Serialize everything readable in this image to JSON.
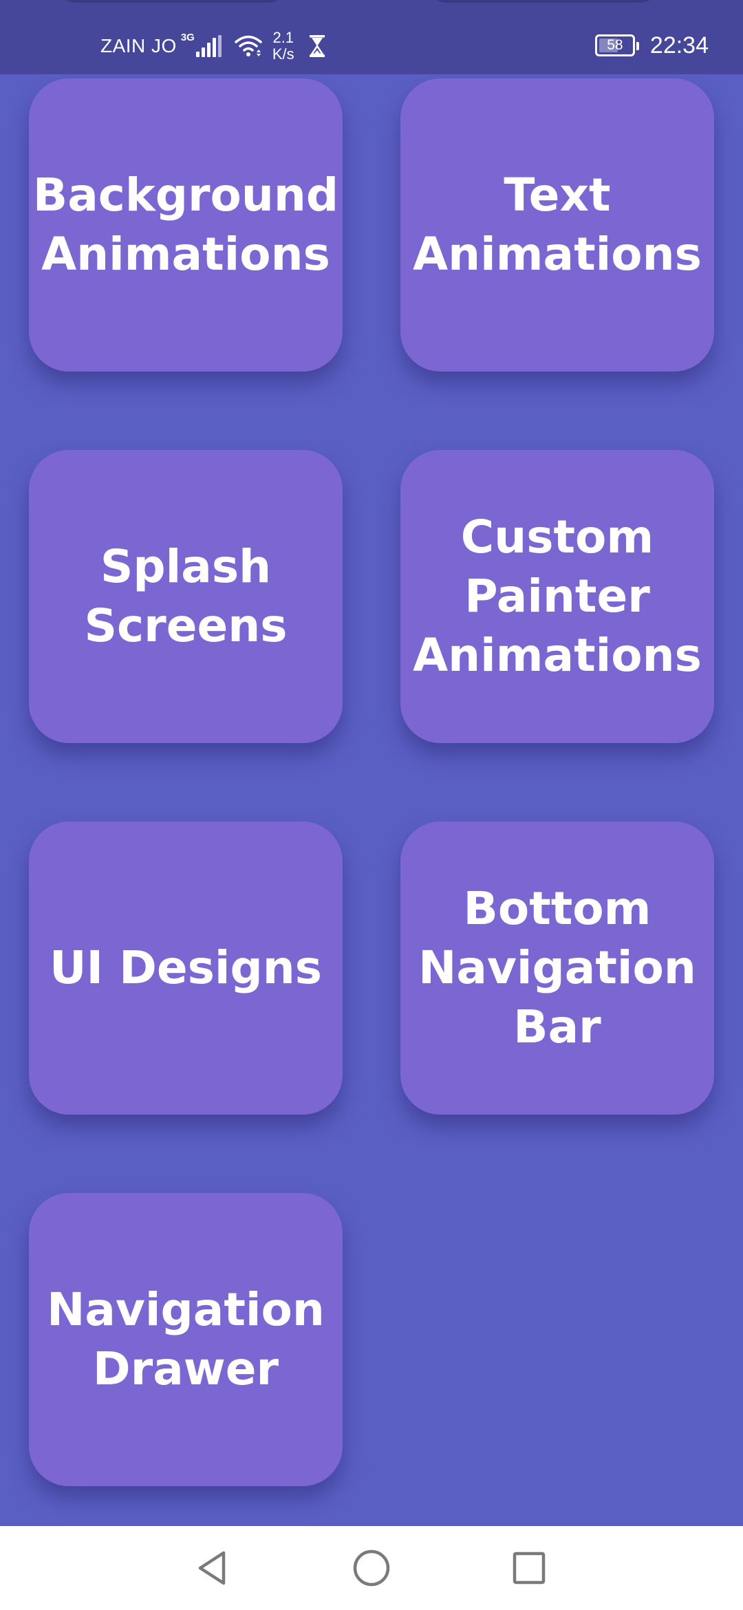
{
  "status_bar": {
    "carrier": "ZAIN JO",
    "network_type": "3G",
    "speed_value": "2.1",
    "speed_unit": "K/s",
    "battery_level": "58",
    "time": "22:34"
  },
  "cards": [
    {
      "label": "Background\nAnimations"
    },
    {
      "label": "Text\nAnimations"
    },
    {
      "label": "Splash\nScreens"
    },
    {
      "label": "Custom\nPainter\nAnimations"
    },
    {
      "label": "UI Designs"
    },
    {
      "label": "Bottom\nNavigation\nBar"
    },
    {
      "label": "Navigation\nDrawer"
    }
  ],
  "colors": {
    "background": "#5a5fc3",
    "status_bar": "#46479a",
    "card": "#7c67d2",
    "nav_bar": "#ffffff",
    "nav_icon": "#7a7a7a"
  },
  "icons": {
    "back": "back-triangle-icon",
    "home": "home-circle-icon",
    "recents": "recents-square-icon"
  }
}
